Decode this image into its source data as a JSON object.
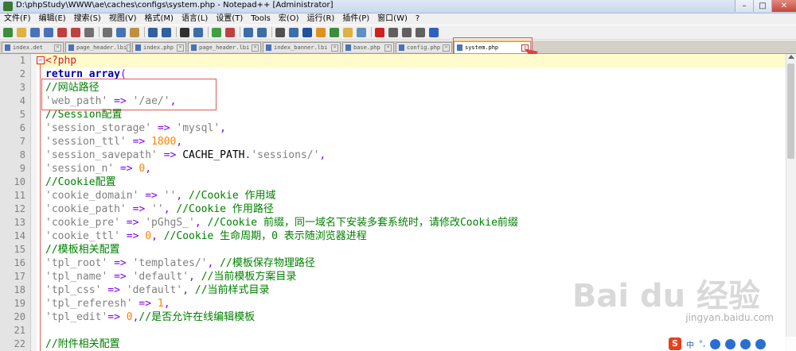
{
  "window": {
    "title": "D:\\phpStudy\\WWW\\ae\\caches\\configs\\system.php - Notepad++ [Administrator]",
    "minimize": "–",
    "maximize": "□",
    "close": "✕"
  },
  "menu": [
    "文件(F)",
    "编辑(E)",
    "搜索(S)",
    "视图(V)",
    "格式(M)",
    "语言(L)",
    "设置(T)",
    "Tools",
    "宏(O)",
    "运行(R)",
    "插件(P)",
    "窗口(W)",
    "?"
  ],
  "toolbar": {
    "buttons": [
      "new-file-icon",
      "open-file-icon",
      "save-icon",
      "save-all-icon",
      "close-icon",
      "close-all-icon",
      "print-icon",
      "cut-icon",
      "copy-icon",
      "paste-icon",
      "undo-icon",
      "redo-icon",
      "find-icon",
      "replace-icon",
      "zoom-in-icon",
      "zoom-out-icon",
      "sync-v-icon",
      "sync-h-icon",
      "word-wrap-icon",
      "show-all-icon",
      "indent-guide-icon",
      "lang-icon",
      "doc-map-icon",
      "folder-icon",
      "monitor-icon",
      "record-icon",
      "stop-icon",
      "play-icon",
      "playmulti-icon",
      "save-macro-icon"
    ],
    "colors": [
      "#3c8d3c",
      "#e0b040",
      "#4a72b8",
      "#4a72b8",
      "#c04040",
      "#c04040",
      "#707070",
      "#707070",
      "#4a72b8",
      "#c09040",
      "#3060a0",
      "#3060a0",
      "#303030",
      "#3c6ea8",
      "#40a040",
      "#c04040",
      "#3c6ea8",
      "#3c6ea8",
      "#505050",
      "#3c6ea8",
      "#2050a0",
      "#e09020",
      "#3c8d3c",
      "#e0b040",
      "#6090c0",
      "#d02020",
      "#606060",
      "#606060",
      "#606060",
      "#3060c0"
    ]
  },
  "tabs": [
    {
      "label": "index.det",
      "active": false
    },
    {
      "label": "page_header.lbi",
      "active": false
    },
    {
      "label": "index.php",
      "active": false
    },
    {
      "label": "page_header.lbi",
      "active": false
    },
    {
      "label": "index_banner.lbi",
      "active": false
    },
    {
      "label": "base.php",
      "active": false
    },
    {
      "label": "config.php",
      "active": false
    },
    {
      "label": "system.php",
      "active": true
    }
  ],
  "editor": {
    "line_numbers": [
      "1",
      "2",
      "3",
      "4",
      "5",
      "6",
      "7",
      "8",
      "9",
      "10",
      "11",
      "12",
      "13",
      "14",
      "15",
      "16",
      "17",
      "18",
      "19",
      "20",
      "21",
      "22"
    ],
    "fold_marker": "−",
    "lines": [
      [
        [
          "php",
          "<?php"
        ]
      ],
      [
        [
          "kw",
          "return "
        ],
        [
          "kw",
          "array"
        ],
        [
          "op",
          "("
        ]
      ],
      [
        [
          "cmt",
          "//网站路径"
        ]
      ],
      [
        [
          "str",
          "'web_path'"
        ],
        [
          "op",
          " => "
        ],
        [
          "str",
          "'/ae/'"
        ],
        [
          "op",
          ","
        ]
      ],
      [
        [
          "cmt",
          "//Session配置"
        ]
      ],
      [
        [
          "str",
          "'session_storage'"
        ],
        [
          "op",
          " => "
        ],
        [
          "str",
          "'mysql'"
        ],
        [
          "op",
          ","
        ]
      ],
      [
        [
          "str",
          "'session_ttl'"
        ],
        [
          "op",
          " => "
        ],
        [
          "num",
          "1800"
        ],
        [
          "op",
          ","
        ]
      ],
      [
        [
          "str",
          "'session_savepath'"
        ],
        [
          "op",
          " => "
        ],
        [
          "plain",
          "CACHE_PATH"
        ],
        [
          "op",
          "."
        ],
        [
          "str",
          "'sessions/'"
        ],
        [
          "op",
          ","
        ]
      ],
      [
        [
          "str",
          "'session_n'"
        ],
        [
          "op",
          " => "
        ],
        [
          "num",
          "0"
        ],
        [
          "op",
          ","
        ]
      ],
      [
        [
          "cmt",
          "//Cookie配置"
        ]
      ],
      [
        [
          "str",
          "'cookie_domain'"
        ],
        [
          "op",
          " => "
        ],
        [
          "str",
          "''"
        ],
        [
          "op",
          ", "
        ],
        [
          "cmt",
          "//Cookie 作用域"
        ]
      ],
      [
        [
          "str",
          "'cookie_path'"
        ],
        [
          "op",
          " => "
        ],
        [
          "str",
          "''"
        ],
        [
          "op",
          ", "
        ],
        [
          "cmt",
          "//Cookie 作用路径"
        ]
      ],
      [
        [
          "str",
          "'cookie_pre'"
        ],
        [
          "op",
          " => "
        ],
        [
          "str",
          "'pGhgS_'"
        ],
        [
          "op",
          ", "
        ],
        [
          "cmt",
          "//Cookie 前缀，同一域名下安装多套系统时，请修改Cookie前缀"
        ]
      ],
      [
        [
          "str",
          "'cookie_ttl'"
        ],
        [
          "op",
          " => "
        ],
        [
          "num",
          "0"
        ],
        [
          "op",
          ", "
        ],
        [
          "cmt",
          "//Cookie 生命周期，0 表示随浏览器进程"
        ]
      ],
      [
        [
          "cmt",
          "//模板相关配置"
        ]
      ],
      [
        [
          "str",
          "'tpl_root'"
        ],
        [
          "op",
          " => "
        ],
        [
          "str",
          "'templates/'"
        ],
        [
          "op",
          ", "
        ],
        [
          "cmt",
          "//模板保存物理路径"
        ]
      ],
      [
        [
          "str",
          "'tpl_name'"
        ],
        [
          "op",
          " => "
        ],
        [
          "str",
          "'default'"
        ],
        [
          "op",
          ", "
        ],
        [
          "cmt",
          "//当前模板方案目录"
        ]
      ],
      [
        [
          "str",
          "'tpl_css'"
        ],
        [
          "op",
          " => "
        ],
        [
          "str",
          "'default'"
        ],
        [
          "op",
          ", "
        ],
        [
          "cmt",
          "//当前样式目录"
        ]
      ],
      [
        [
          "str",
          "'tpl_referesh'"
        ],
        [
          "op",
          " => "
        ],
        [
          "num",
          "1"
        ],
        [
          "op",
          ","
        ]
      ],
      [
        [
          "str",
          "'tpl_edit'"
        ],
        [
          "op",
          "=> "
        ],
        [
          "num",
          "0"
        ],
        [
          "op",
          ","
        ],
        [
          "cmt",
          "//是否允许在线编辑模板"
        ]
      ],
      [],
      [
        [
          "cmt",
          "//附件相关配置"
        ]
      ]
    ]
  },
  "watermark": {
    "logo": "Bai du 经验",
    "url": "jingyan.baidu.com"
  },
  "ime": {
    "logo": "S",
    "mode": "中",
    "punct": "°,"
  }
}
